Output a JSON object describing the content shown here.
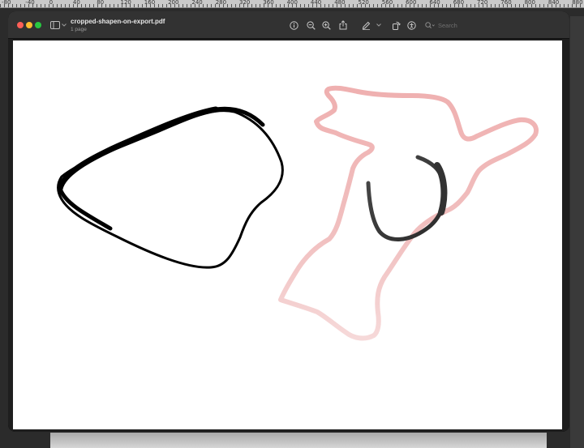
{
  "ruler": {
    "labels": [
      "-80",
      "-40",
      "0",
      "40",
      "80",
      "120",
      "160",
      "200",
      "240",
      "280",
      "320",
      "360",
      "400",
      "440",
      "480",
      "520",
      "560",
      "600",
      "640",
      "680",
      "720",
      "760",
      "800",
      "840",
      "880"
    ]
  },
  "window": {
    "title": "cropped-shapen-on-export.pdf",
    "subtitle": "1 page"
  },
  "toolbar": {
    "search_placeholder": "Search",
    "icons": [
      "sidebar-icon",
      "info-icon",
      "zoom-out-icon",
      "zoom-in-icon",
      "share-icon",
      "markup-pen-icon",
      "chevron-down-icon",
      "rotate-icon",
      "accessibility-icon",
      "search-icon"
    ]
  },
  "document": {
    "shapes": [
      {
        "name": "black-closed-blob-stroke",
        "color": "#000000"
      },
      {
        "name": "pink-freeform-outline-stroke",
        "color": "#efb4b4"
      },
      {
        "name": "dark-gray-u-curve-stroke",
        "color": "#3a3a3a"
      }
    ]
  }
}
